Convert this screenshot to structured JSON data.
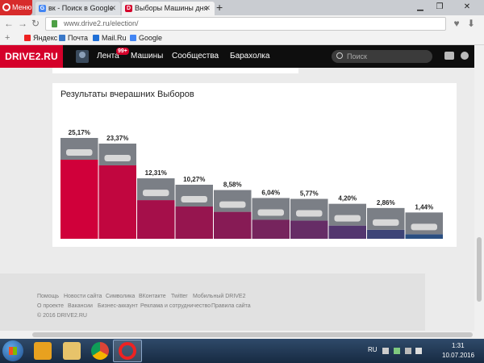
{
  "browser": {
    "menu_label": "Меню",
    "tabs": [
      {
        "title": "вк - Поиск в Google",
        "favicon": "google-icon"
      },
      {
        "title": "Выборы Машины дня",
        "favicon": "drive2-icon"
      }
    ],
    "new_tab": "+",
    "address": "www.drive2.ru/election/",
    "bookmarks": [
      {
        "label": "Яндекс",
        "icon": "yandex-icon",
        "color": "#e22"
      },
      {
        "label": "Почта",
        "icon": "mail-icon",
        "color": "#3a78c8"
      },
      {
        "label": "Mail.Ru",
        "icon": "mailru-icon",
        "color": "#1f6fd6"
      },
      {
        "label": "Google",
        "icon": "google-icon",
        "color": "#4285f4"
      }
    ]
  },
  "site": {
    "logo": "DRIVE2.RU",
    "badge": "99+",
    "nav": [
      "Лента",
      "Машины",
      "Сообщества",
      "Барахолка"
    ],
    "search_placeholder": "Поиск",
    "accent": "#d5002a"
  },
  "results": {
    "title": "Результаты вчерашних Выборов"
  },
  "chart_data": {
    "type": "bar",
    "unit": "%",
    "categories": [
      "",
      "",
      "",
      "",
      "",
      "",
      "",
      "",
      "",
      ""
    ],
    "values": [
      25.17,
      23.37,
      12.31,
      10.27,
      8.58,
      6.04,
      5.77,
      4.2,
      2.86,
      1.44
    ],
    "labels": [
      "25,17%",
      "23,37%",
      "12,31%",
      "10,27%",
      "8,58%",
      "6,04%",
      "5,77%",
      "4,20%",
      "2,86%",
      "1,44%"
    ],
    "colors": [
      "#d0003a",
      "#c1063f",
      "#a50f4a",
      "#96154f",
      "#871b55",
      "#76245d",
      "#662d66",
      "#53366f",
      "#3d4477",
      "#2a4f82"
    ],
    "ylim": [
      0,
      25.17
    ]
  },
  "footer": {
    "row1": [
      "Помощь",
      "Новости сайта",
      "Символика",
      "ВКонтакте",
      "Twitter",
      "Мобильный DRIVE2"
    ],
    "row2": [
      "О проекте",
      "Вакансии",
      "Бизнес-аккаунт",
      "Реклама и сотрудничество",
      "Правила сайта"
    ],
    "copyright": "© 2016 DRIVE2.RU"
  },
  "taskbar": {
    "lang": "RU",
    "time": "1:31",
    "date": "10.07.2016"
  }
}
